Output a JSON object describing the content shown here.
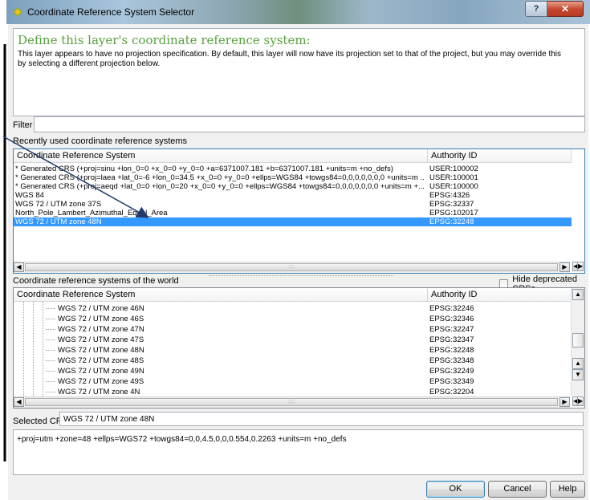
{
  "window": {
    "title": "Coordinate Reference System Selector",
    "help_button": "?",
    "close_button": "✕"
  },
  "hint": {
    "title": "Define this layer's coordinate reference system:",
    "text": "This layer appears to have no projection specification. By default, this layer will now have its projection set to that of the project, but you may override this by selecting a different projection below."
  },
  "filter": {
    "label": "Filter",
    "value": ""
  },
  "recent": {
    "label": "Recently used coordinate reference systems",
    "headers": {
      "crs": "Coordinate Reference System",
      "authority": "Authority ID"
    },
    "rows": [
      {
        "crs": "* Generated CRS (+proj=sinu +lon_0=0 +x_0=0 +y_0=0 +a=6371007.181 +b=6371007.181 +units=m +no_defs)",
        "authority": "USER:100002"
      },
      {
        "crs": "* Generated CRS (+proj=laea +lat_0=-6 +lon_0=34.5 +x_0=0 +y_0=0 +ellps=WGS84 +towgs84=0,0,0,0,0,0,0 +units=m ...",
        "authority": "USER:100001"
      },
      {
        "crs": "* Generated CRS (+proj=aeqd +lat_0=0 +lon_0=20 +x_0=0 +y_0=0 +ellps=WGS84 +towgs84=0,0,0,0,0,0,0 +units=m +...",
        "authority": "USER:100000"
      },
      {
        "crs": "WGS 84",
        "authority": "EPSG:4326"
      },
      {
        "crs": "WGS 72 / UTM zone 37S",
        "authority": "EPSG:32337"
      },
      {
        "crs": "North_Pole_Lambert_Azimuthal_Equal_Area",
        "authority": "EPSG:102017"
      },
      {
        "crs": "WGS 72 / UTM zone 48N",
        "authority": "EPSG:32248",
        "selected": true
      }
    ]
  },
  "world": {
    "label": "Coordinate reference systems of the world",
    "hide_deprecated": "Hide deprecated CRSs",
    "headers": {
      "crs": "Coordinate Reference System",
      "authority": "Authority ID"
    },
    "rows": [
      {
        "crs": "WGS 72 / UTM zone 46N",
        "authority": "EPSG:32246"
      },
      {
        "crs": "WGS 72 / UTM zone 46S",
        "authority": "EPSG:32346"
      },
      {
        "crs": "WGS 72 / UTM zone 47N",
        "authority": "EPSG:32247"
      },
      {
        "crs": "WGS 72 / UTM zone 47S",
        "authority": "EPSG:32347"
      },
      {
        "crs": "WGS 72 / UTM zone 48N",
        "authority": "EPSG:32248"
      },
      {
        "crs": "WGS 72 / UTM zone 48S",
        "authority": "EPSG:32348"
      },
      {
        "crs": "WGS 72 / UTM zone 49N",
        "authority": "EPSG:32249"
      },
      {
        "crs": "WGS 72 / UTM zone 49S",
        "authority": "EPSG:32349"
      },
      {
        "crs": "WGS 72 / UTM zone 4N",
        "authority": "EPSG:32204"
      }
    ]
  },
  "selected_crs": {
    "label": "Selected CRS:",
    "value": "WGS 72 / UTM zone 48N"
  },
  "proj_string": "+proj=utm +zone=48 +ellps=WGS72 +towgs84=0,0,4.5,0,0,0.554,0.2263 +units=m +no_defs",
  "buttons": {
    "ok": "OK",
    "cancel": "Cancel",
    "help": "Help"
  },
  "colors": {
    "selection": "#3399ff",
    "hint_title": "#58a03e",
    "annotation_arrow": "#1f3a6b"
  }
}
